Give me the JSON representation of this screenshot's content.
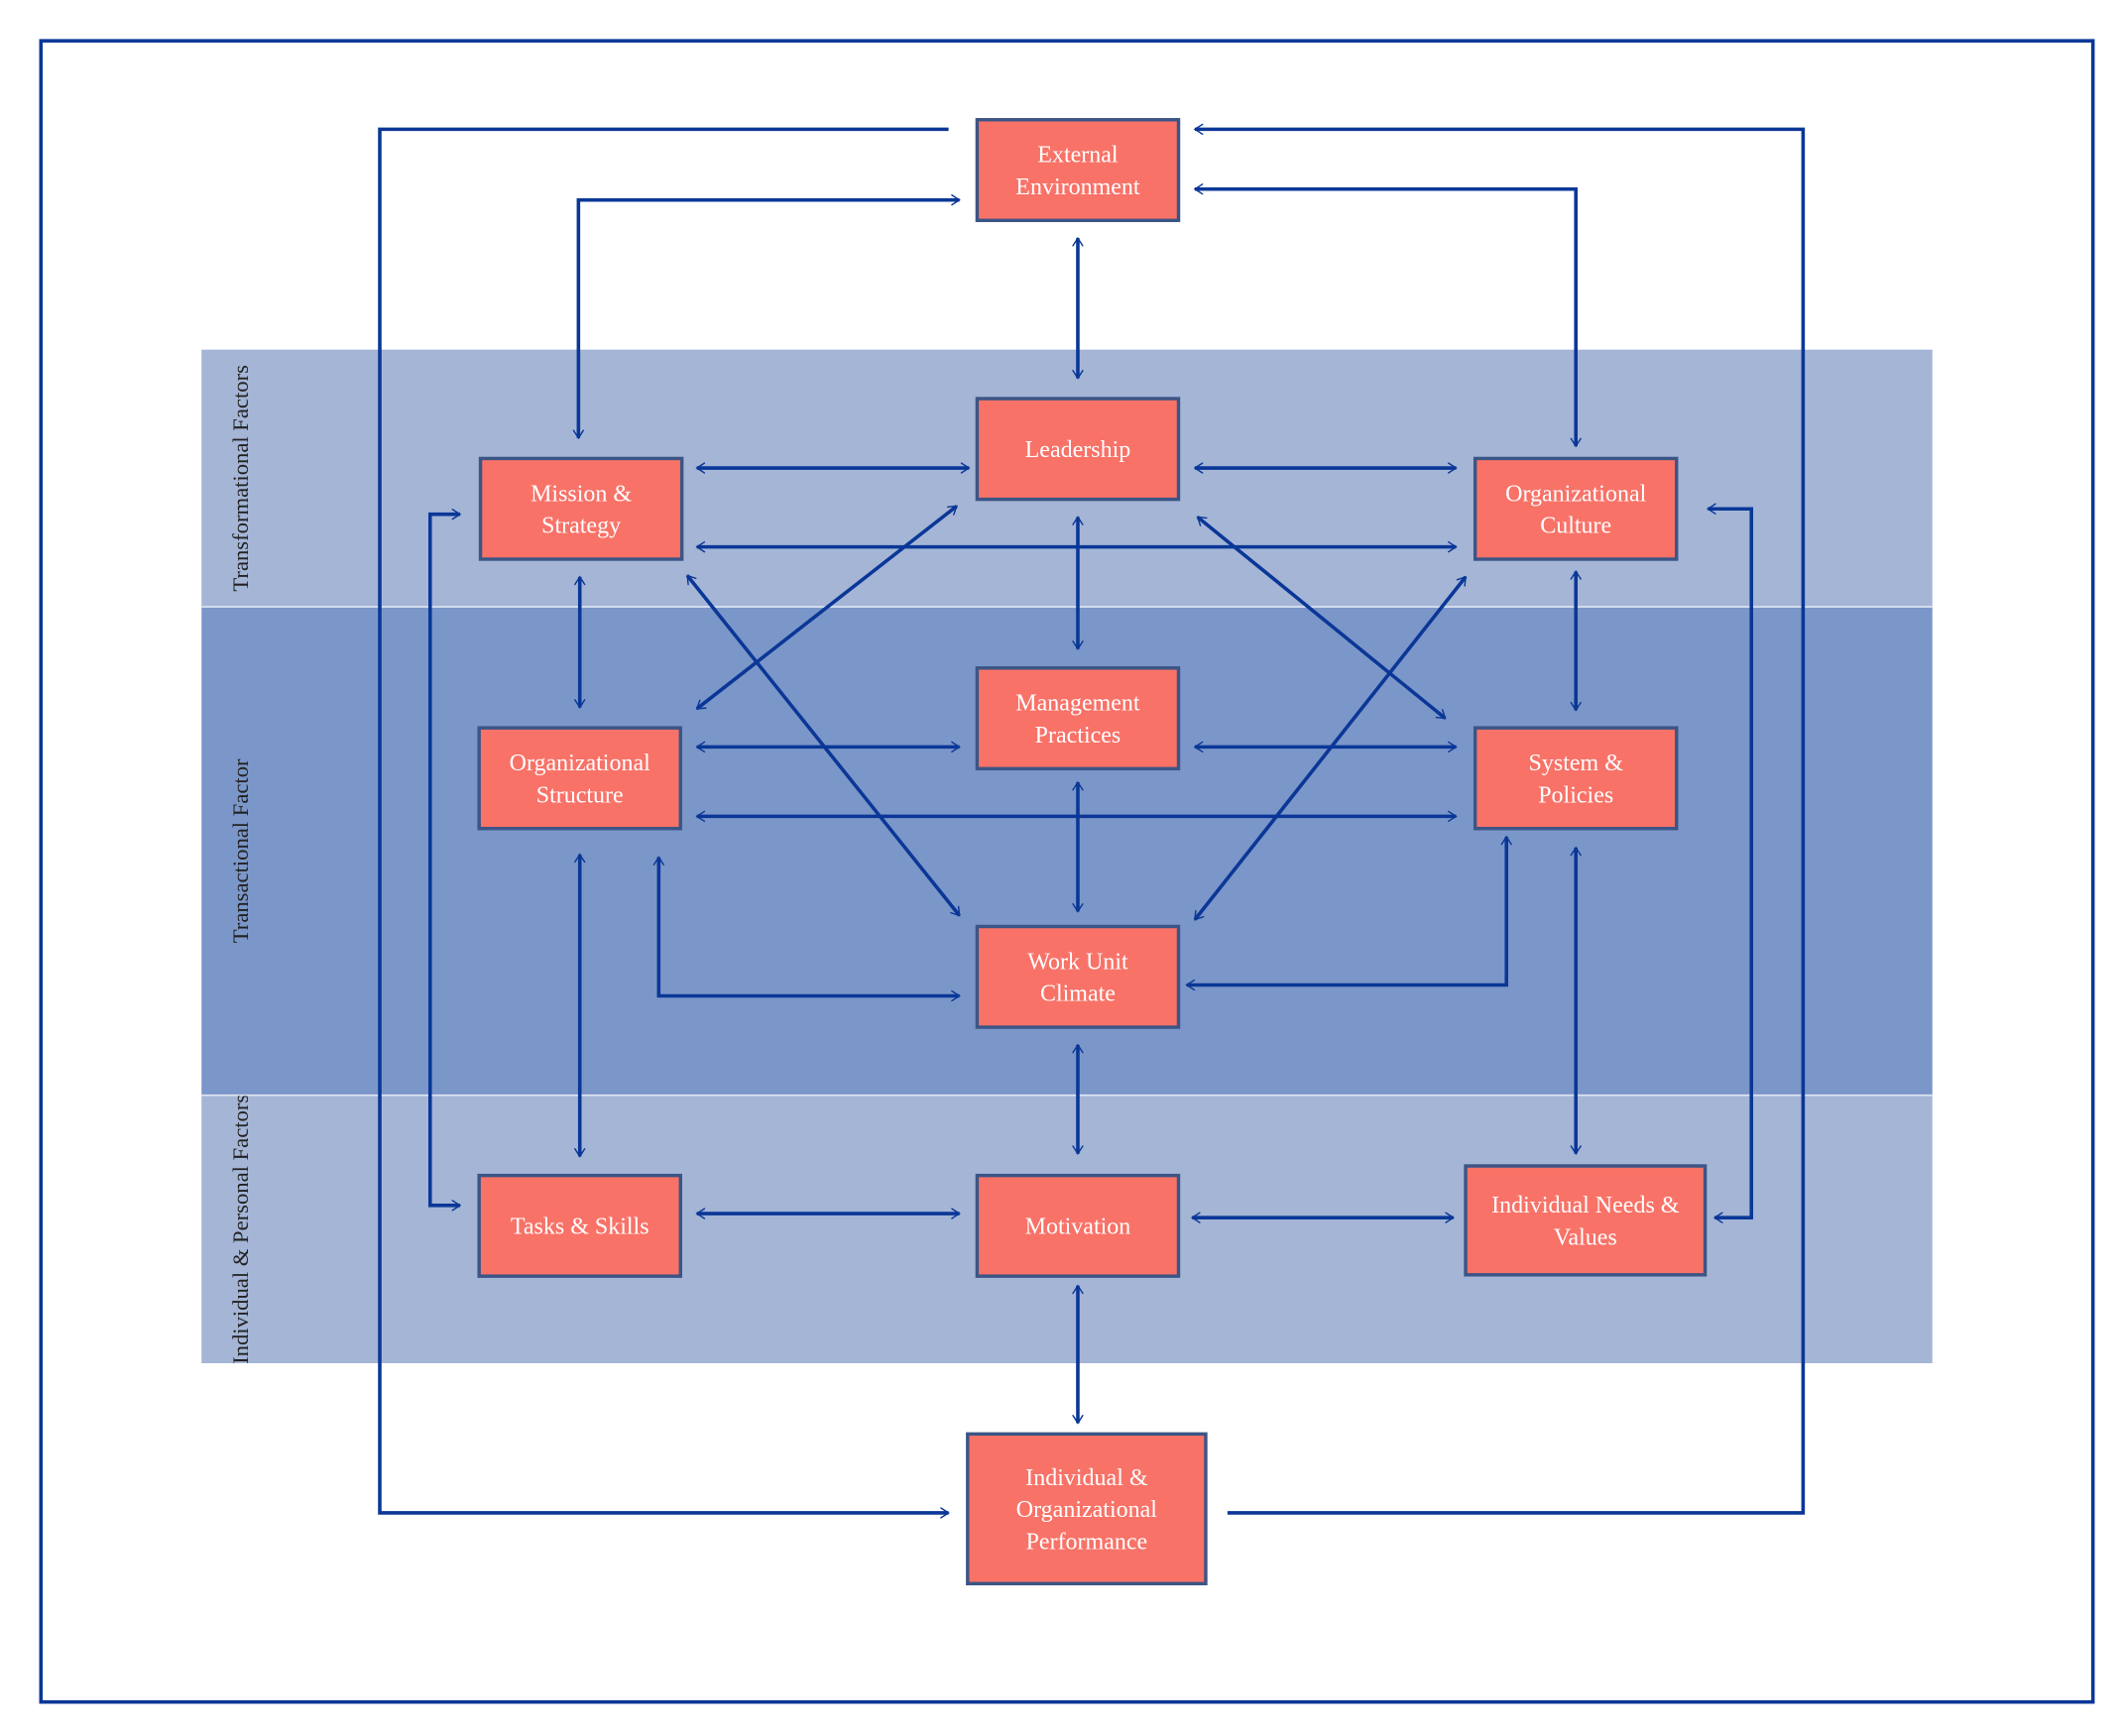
{
  "colors": {
    "frame": "#0a3797",
    "arrow": "#0a3797",
    "box_fill": "#f87268",
    "box_border": "#3b5586",
    "band_light": "#a4b5d6",
    "band_dark": "#7b96c8"
  },
  "bands": [
    {
      "id": "transformational",
      "label": "Transformational Factors"
    },
    {
      "id": "transactional",
      "label": "Transactional Factor"
    },
    {
      "id": "individual",
      "label": "Individual & Personal Factors"
    }
  ],
  "boxes": [
    {
      "id": "external",
      "lines": [
        "External",
        "Environment"
      ]
    },
    {
      "id": "leadership",
      "lines": [
        "Leadership"
      ]
    },
    {
      "id": "mission",
      "lines": [
        "Mission &",
        "Strategy"
      ]
    },
    {
      "id": "culture",
      "lines": [
        "Organizational",
        "Culture"
      ]
    },
    {
      "id": "structure",
      "lines": [
        "Organizational",
        "Structure"
      ]
    },
    {
      "id": "management",
      "lines": [
        "Management",
        "Practices"
      ]
    },
    {
      "id": "systems",
      "lines": [
        "System &",
        "Policies"
      ]
    },
    {
      "id": "climate",
      "lines": [
        "Work Unit",
        "Climate"
      ]
    },
    {
      "id": "tasks",
      "lines": [
        "Tasks & Skills"
      ]
    },
    {
      "id": "motivation",
      "lines": [
        "Motivation"
      ]
    },
    {
      "id": "needs",
      "lines": [
        "Individual Needs &",
        "Values"
      ]
    },
    {
      "id": "performance",
      "lines": [
        "Individual &",
        "Organizational",
        "Performance"
      ]
    }
  ],
  "connections": [
    {
      "from": "external",
      "to": "performance",
      "arrows": "end",
      "route": "left-loop"
    },
    {
      "from": "performance",
      "to": "external",
      "arrows": "end",
      "route": "right-loop"
    },
    {
      "from": "mission",
      "to": "external",
      "arrows": "both"
    },
    {
      "from": "external",
      "to": "culture",
      "arrows": "both"
    },
    {
      "from": "external",
      "to": "leadership",
      "arrows": "both"
    },
    {
      "from": "mission",
      "to": "leadership",
      "arrows": "both"
    },
    {
      "from": "leadership",
      "to": "culture",
      "arrows": "both"
    },
    {
      "from": "mission",
      "to": "culture",
      "arrows": "both"
    },
    {
      "from": "leadership",
      "to": "management",
      "arrows": "both"
    },
    {
      "from": "mission",
      "to": "structure",
      "arrows": "both"
    },
    {
      "from": "culture",
      "to": "systems",
      "arrows": "both"
    },
    {
      "from": "leadership",
      "to": "structure",
      "arrows": "both"
    },
    {
      "from": "mission",
      "to": "climate",
      "arrows": "both"
    },
    {
      "from": "leadership",
      "to": "systems",
      "arrows": "both"
    },
    {
      "from": "culture",
      "to": "climate",
      "arrows": "both"
    },
    {
      "from": "structure",
      "to": "management",
      "arrows": "both"
    },
    {
      "from": "management",
      "to": "systems",
      "arrows": "both"
    },
    {
      "from": "structure",
      "to": "systems",
      "arrows": "both"
    },
    {
      "from": "management",
      "to": "climate",
      "arrows": "both"
    },
    {
      "from": "structure",
      "to": "climate",
      "arrows": "both"
    },
    {
      "from": "systems",
      "to": "climate",
      "arrows": "both"
    },
    {
      "from": "structure",
      "to": "tasks",
      "arrows": "both"
    },
    {
      "from": "mission",
      "to": "tasks",
      "arrows": "both"
    },
    {
      "from": "systems",
      "to": "needs",
      "arrows": "both"
    },
    {
      "from": "culture",
      "to": "needs",
      "arrows": "both"
    },
    {
      "from": "climate",
      "to": "motivation",
      "arrows": "both"
    },
    {
      "from": "tasks",
      "to": "motivation",
      "arrows": "both"
    },
    {
      "from": "motivation",
      "to": "needs",
      "arrows": "both"
    },
    {
      "from": "motivation",
      "to": "performance",
      "arrows": "both"
    }
  ]
}
